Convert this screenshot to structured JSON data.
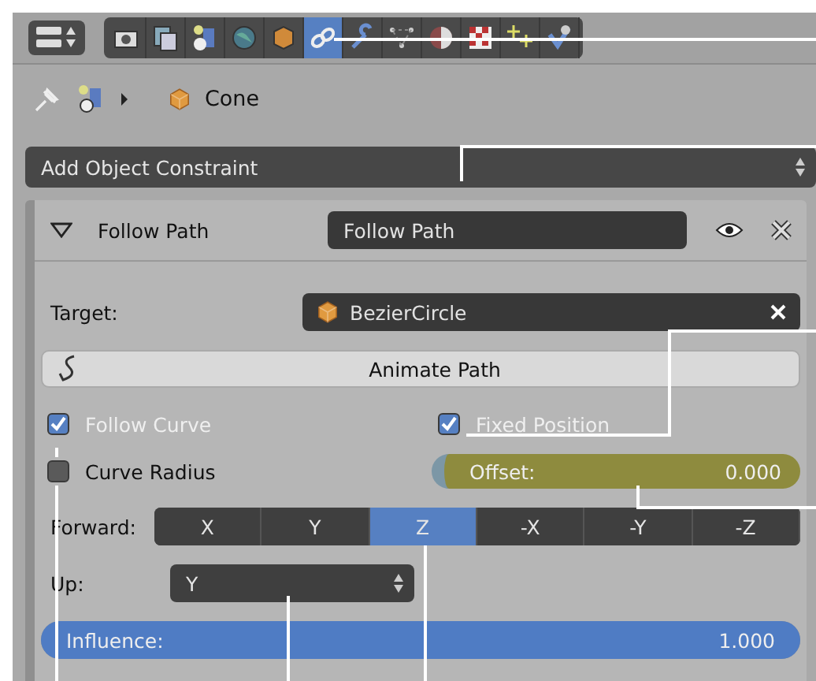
{
  "header": {
    "tabs": [
      {
        "selected": false
      },
      {
        "selected": false
      },
      {
        "selected": false
      },
      {
        "selected": false
      },
      {
        "selected": false
      },
      {
        "selected": true
      },
      {
        "selected": false
      },
      {
        "selected": false
      },
      {
        "selected": false
      },
      {
        "selected": false
      },
      {
        "selected": false
      },
      {
        "selected": false
      }
    ]
  },
  "breadcrumb": {
    "object": "Cone"
  },
  "add_constraint": {
    "label": "Add Object Constraint"
  },
  "constraint": {
    "expanded": true,
    "type_label": "Follow Path",
    "name": "Follow Path",
    "visible": true,
    "target": {
      "label": "Target:",
      "value": "BezierCircle"
    },
    "animate_button": "Animate Path",
    "options": [
      {
        "label": "Follow Curve",
        "checked": true
      },
      {
        "label": "Fixed Position",
        "checked": true
      },
      {
        "label": "Curve Radius",
        "checked": false
      }
    ],
    "offset": {
      "label": "Offset:",
      "value": "0.000",
      "keyed": true
    },
    "forward": {
      "label": "Forward:",
      "options": [
        {
          "label": "X",
          "selected": false
        },
        {
          "label": "Y",
          "selected": false
        },
        {
          "label": "Z",
          "selected": true
        },
        {
          "label": "-X",
          "selected": false
        },
        {
          "label": "-Y",
          "selected": false
        },
        {
          "label": "-Z",
          "selected": false
        }
      ]
    },
    "up": {
      "label": "Up:",
      "value": "Y"
    },
    "influence": {
      "label": "Influence:",
      "value": "1.000",
      "level": 1
    }
  }
}
